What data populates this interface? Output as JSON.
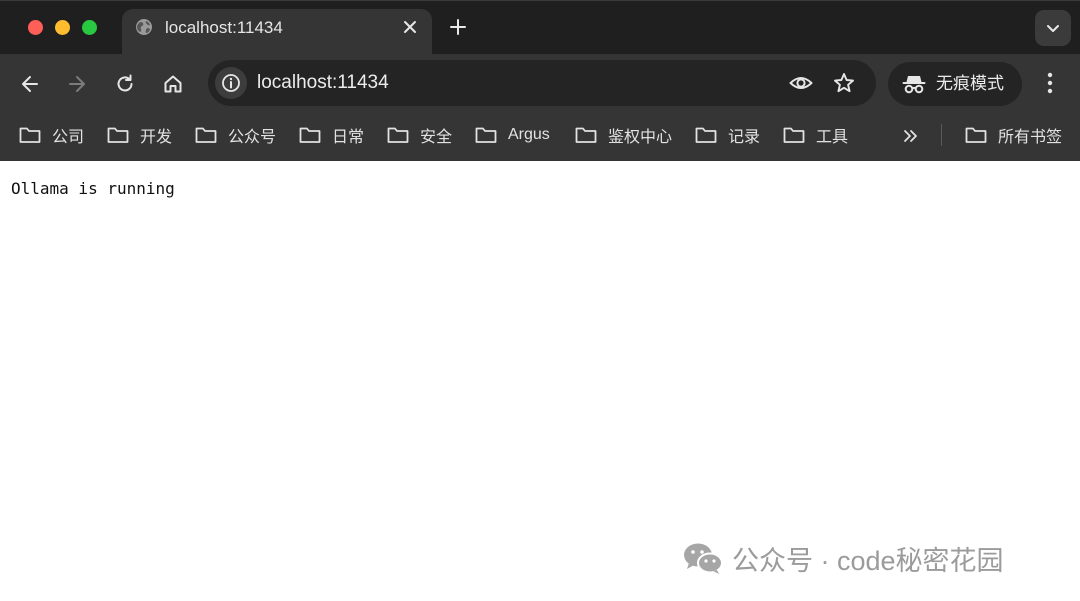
{
  "tab": {
    "title": "localhost:11434",
    "icons": {
      "favicon": "globe-icon",
      "close": "close-icon",
      "new_tab": "plus-icon",
      "search_tabs": "chevron-down-icon"
    }
  },
  "toolbar": {
    "url": "localhost:11434",
    "incognito_label": "无痕模式",
    "icons": [
      "back-arrow-icon",
      "forward-arrow-icon",
      "reload-icon",
      "home-icon",
      "info-icon",
      "eye-icon",
      "star-icon",
      "incognito-icon",
      "more-vertical-icon"
    ]
  },
  "bookmarks": {
    "items": [
      {
        "label": "公司"
      },
      {
        "label": "开发"
      },
      {
        "label": "公众号"
      },
      {
        "label": "日常"
      },
      {
        "label": "安全"
      },
      {
        "label": "Argus"
      },
      {
        "label": "鉴权中心"
      },
      {
        "label": "记录"
      },
      {
        "label": "工具"
      }
    ],
    "overflow_icon": "double-chevron-right-icon",
    "all_bookmarks_label": "所有书签"
  },
  "page": {
    "text": "Ollama is running"
  },
  "watermark": {
    "text": "公众号 · code秘密花园",
    "icon": "wechat-icon"
  },
  "colors": {
    "titlebar": "#1f1f1f",
    "toolbar": "#353535",
    "omnibox": "#242424",
    "close_red": "#fe5f57",
    "minimize_yellow": "#febc2e",
    "zoom_green": "#28c840",
    "page_background": "#ffffff"
  }
}
